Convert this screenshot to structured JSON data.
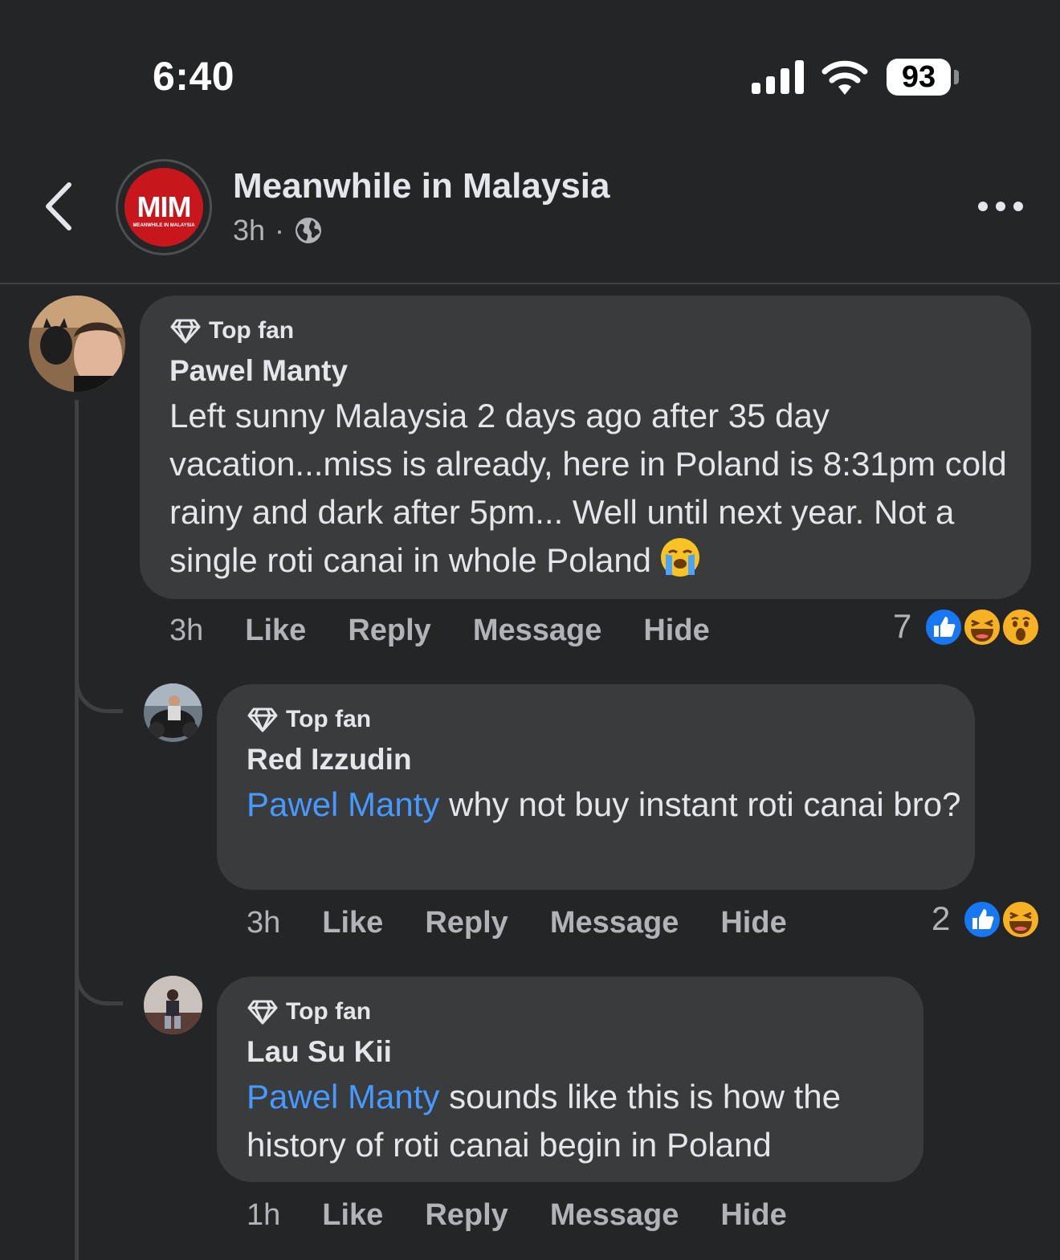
{
  "status_bar": {
    "time": "6:40",
    "battery": "93"
  },
  "header": {
    "page_name": "Meanwhile in Malaysia",
    "time_ago": "3h",
    "separator": "·",
    "logo_text": "MIM",
    "logo_subtext": "MEANWHILE IN MALAYSIA"
  },
  "comments": [
    {
      "badge": "Top fan",
      "author": "Pawel Manty",
      "text": "Left sunny Malaysia 2 days ago after 35 day vacation...miss is already, here in Poland is 8:31pm cold rainy and dark after 5pm... Well until next year. Not a single roti canai in whole Poland",
      "emoji": "crying-face",
      "time": "3h",
      "like": "Like",
      "reply": "Reply",
      "message": "Message",
      "hide": "Hide",
      "reaction_count": "7",
      "reactions": [
        "like",
        "haha",
        "wow"
      ]
    },
    {
      "badge": "Top fan",
      "author": "Red Izzudin",
      "mention": "Pawel Manty",
      "text": " why not buy instant roti canai bro?",
      "time": "3h",
      "like": "Like",
      "reply": "Reply",
      "message": "Message",
      "hide": "Hide",
      "reaction_count": "2",
      "reactions": [
        "like",
        "haha"
      ]
    },
    {
      "badge": "Top fan",
      "author": "Lau Su Kii",
      "mention": "Pawel Manty",
      "text": " sounds like this is how the history of roti canai begin in Poland",
      "time": "1h",
      "like": "Like",
      "reply": "Reply",
      "message": "Message",
      "hide": "Hide"
    }
  ],
  "colors": {
    "background": "#242527",
    "bubble": "#3a3b3c",
    "mention": "#4599ff",
    "like_blue": "#1877f2",
    "logo_red": "#c8161d"
  }
}
